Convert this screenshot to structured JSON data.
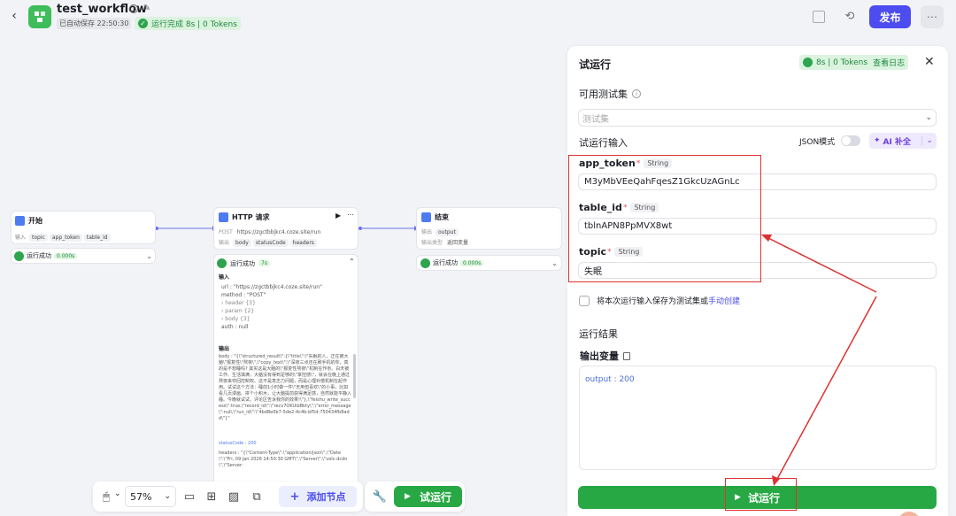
{
  "header": {
    "title": "test_workflow",
    "autosave": "已自动保存 22:50:30",
    "run_status": "运行完成 8s | 0 Tokens",
    "publish_label": "发布"
  },
  "canvas": {
    "start_node": {
      "title": "开始",
      "input_label": "输入",
      "params": [
        "topic",
        "app_token",
        "table_id"
      ],
      "status": "运行成功",
      "time": "0.000s"
    },
    "http_node": {
      "title": "HTTP 请求",
      "method": "POST",
      "url": "https://zgctbbjkc4.coze.site/run",
      "output_label": "输出",
      "outputs": [
        "body",
        "statusCode",
        "headers"
      ],
      "status": "运行成功",
      "time": "7s",
      "input_title": "输入",
      "input_lines": [
        "url : \"https://zgctbbjkc4.coze.site/run\"",
        "method : \"POST\"",
        "› header {3}",
        "› param {2}",
        "› body {3}",
        "auth : null"
      ],
      "output_title": "输出",
      "output_text": "body : \"{\\\"structured_result\\\":{\\\"title\\\":\\\"失眠的人，正在被大脑\\\"报复性\\\"熬夜\\\",\\\"copy_text\\\":\\\"深夜三点还在刷手机的你，真的是不想睡吗? 其实这是大脑的\\\"报复性熬夜\\\"机制在作祟。白天被工作、生活填满，大脑没有得到足够的\\\"掌控感\\\"，就会在晚上通过熬夜来夺回控制权。这不是意志力问题，而是心理补偿机制在起作用。试试这个方法：睡前1小时做一件\\\"无用但喜欢\\\"的小事，比如看几页漫画、拼个小积木，让大脑提前获得满足感，自然就能平静入睡。今晚就试试，评论区告诉我你的效果!\\\"},\\\"feishu_write_success\\\":true,\\\"record_id\\\":\\\"recv7OKUibBkty\\\",\\\"error_message\\\":null,\\\"run_id\\\":\\\"4bd8e0b7-5de2-4c4b-bf5d-750434fb8add\\\"}\"",
      "status_code_line": "statusCode : 200",
      "headers_line": "headers : \"{\\\"Content-Type\\\":\\\"application/json\\\",\\\"Date\\\":\\\"Fri, 09 Jan 2026 14:50:30 GMT\\\",\\\"Server\\\":\\\"volc-dcdn\\\",\\\"Server-"
    },
    "end_node": {
      "title": "结束",
      "output_label": "输出",
      "output_var": "output",
      "output_type_label": "输出类型",
      "output_type": "返回变量",
      "status": "运行成功",
      "time": "0.000s"
    }
  },
  "toolbar": {
    "zoom": "57%",
    "add_node": "添加节点",
    "run": "试运行"
  },
  "panel": {
    "title": "试运行",
    "status": "8s | 0 Tokens",
    "view_log": "查看日志",
    "testset_label": "可用测试集",
    "testset_placeholder": "测试集",
    "run_input_label": "试运行输入",
    "json_mode": "JSON模式",
    "ai_fill": "AI 补全",
    "fields": [
      {
        "name": "app_token",
        "type": "String",
        "value": "M3yMbVEeQahFqesZ1GkcUzAGnLc"
      },
      {
        "name": "table_id",
        "type": "String",
        "value": "tblnAPN8PpMVX8wt"
      },
      {
        "name": "topic",
        "type": "String",
        "value": "失眠"
      }
    ],
    "save_as_testset": "将本次运行输入保存为测试集或",
    "manual_create": "手动创建",
    "result_title": "运行结果",
    "output_var_title": "输出变量",
    "output_line": "output : 200",
    "run_label": "试运行"
  },
  "colors": {
    "accent_blue": "#4c4cf0",
    "success_green": "#27a844",
    "annotation_red": "#e03131"
  }
}
